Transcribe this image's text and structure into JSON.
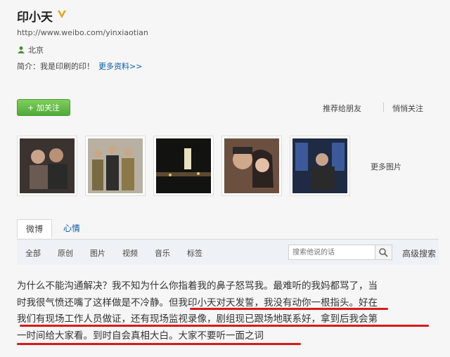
{
  "profile": {
    "name": "印小天",
    "url": "http://www.weibo.com/yinxiaotian",
    "location": "北京",
    "intro_label": "简介：",
    "intro_text": "我是印刷的印！",
    "more_info": "更多资料>>"
  },
  "actions": {
    "follow": "+ 加关注",
    "recommend": "推荐给朋友",
    "unfollow": "悄悄关注"
  },
  "photos": {
    "more": "更多图片",
    "count": 5
  },
  "tabs": [
    {
      "label": "微博",
      "active": true
    },
    {
      "label": "心情",
      "active": false
    }
  ],
  "filters": [
    "全部",
    "原创",
    "图片",
    "视频",
    "音乐",
    "标签"
  ],
  "search": {
    "placeholder": "搜索他说的话",
    "advanced": "高级搜索"
  },
  "post": {
    "lines": [
      "为什么不能沟通解决？我不知为什么你指着我的鼻子怒骂我。最难听的我妈都骂了，当",
      "时我很气愤还嘴了这样做是不冷静。但我印小天对天发誓，我没有动你一根指头。好在",
      "我们有现场工作人员做证，还有现场监视录像，剧组现已跟场地联系好，拿到后我会第",
      "一时间给大家看。到时自会真相大白。大家不要听一面之词"
    ]
  },
  "colors": {
    "follow_green": "#5cb83e",
    "link_blue": "#0a5cab",
    "underline_red": "#d81a1a"
  }
}
